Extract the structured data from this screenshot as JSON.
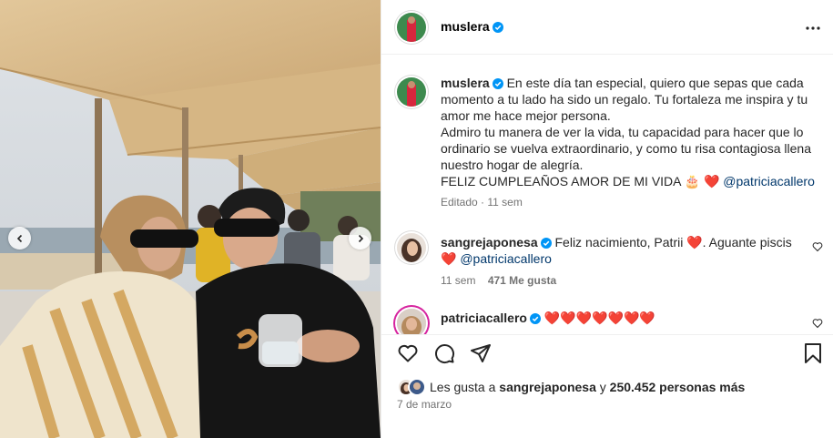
{
  "post_header": {
    "username": "muslera",
    "verified_icon": "verified-badge-icon",
    "more_icon": "more-options-icon"
  },
  "caption": {
    "username": "muslera",
    "line1": "En este día tan especial, quiero que sepas que cada momento a tu lado ha sido un regalo. Tu fortaleza me inspira y tu amor me hace mejor persona.",
    "line2": "Admiro tu manera de ver la vida, tu capacidad para hacer que lo ordinario se vuelva extraordinario, y como tu risa contagiosa llena nuestro hogar de alegría.",
    "line3": "FELIZ CUMPLEAÑOS AMOR DE MI VIDA",
    "emoji_cake": "🎂",
    "emoji_heart": "❤️",
    "mention": "@patriciacallero",
    "edited": "Editado",
    "time": "11 sem"
  },
  "comments": [
    {
      "username": "sangrejaponesa",
      "text": "Feliz nacimiento, Patrii",
      "emoji": "❤️",
      "text2": ". Aguante piscis",
      "emoji2": "❤️",
      "mention": "@patriciacallero",
      "time": "11 sem",
      "likes": "471 Me gusta"
    },
    {
      "username": "patriciacallero",
      "hearts": "❤️❤️❤️❤️❤️❤️❤️"
    }
  ],
  "likes": {
    "prefix": "Les gusta a",
    "user": "sangrejaponesa",
    "connector": "y",
    "others": "250.452 personas más"
  },
  "date": "7 de marzo",
  "colors": {
    "verified": "#0095f6",
    "heart": "#ed4956",
    "mention": "#00376b",
    "muted": "#737373"
  }
}
